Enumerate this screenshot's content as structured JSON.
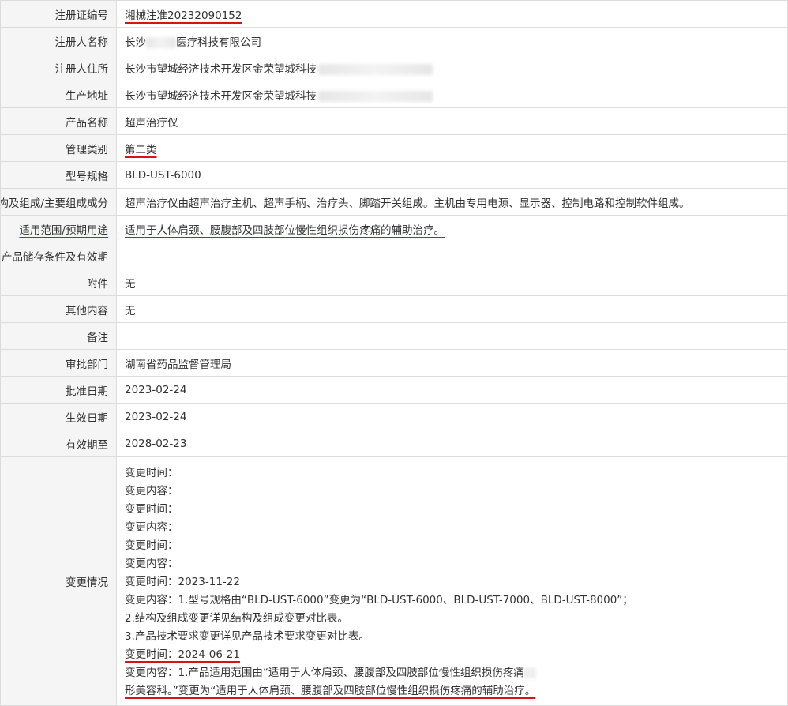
{
  "rows": [
    {
      "label": "注册证编号",
      "value": "湘械注准20232090152",
      "mark": true
    },
    {
      "label": "注册人名称",
      "value_prefix": "长沙",
      "value_suffix": "医疗科技有限公司",
      "redacted": true
    },
    {
      "label": "注册人住所",
      "value": "长沙市望城经济技术开发区金荣望城科技",
      "redacted_tail": true
    },
    {
      "label": "生产地址",
      "value": "长沙市望城经济技术开发区金荣望城科技",
      "redacted_tail": true
    },
    {
      "label": "产品名称",
      "value": "超声治疗仪"
    },
    {
      "label": "管理类别",
      "value": "第二类",
      "mark": true
    },
    {
      "label": "型号规格",
      "value": "BLD-UST-6000"
    },
    {
      "label": "结构及组成/主要组成成分",
      "value": "超声治疗仪由超声治疗主机、超声手柄、治疗头、脚踏开关组成。主机由专用电源、显示器、控制电路和控制软件组成。"
    },
    {
      "label": "适用范围/预期用途",
      "value": "适用于人体肩颈、腰腹部及四肢部位慢性组织损伤疼痛的辅助治疗。",
      "mark": true,
      "mark_label": true
    },
    {
      "label": "产品储存条件及有效期",
      "value": ""
    },
    {
      "label": "附件",
      "value": "无"
    },
    {
      "label": "其他内容",
      "value": "无"
    },
    {
      "label": "备注",
      "value": ""
    },
    {
      "label": "审批部门",
      "value": "湖南省药品监督管理局"
    },
    {
      "label": "批准日期",
      "value": "2023-02-24"
    },
    {
      "label": "生效日期",
      "value": "2023-02-24"
    },
    {
      "label": "有效期至",
      "value": "2028-02-23"
    }
  ],
  "changes": {
    "label": "变更情况",
    "lines": [
      "变更时间：",
      "变更内容：",
      "变更时间：",
      "变更内容：",
      "变更时间：",
      "变更内容：",
      "变更时间：2023-11-22",
      "变更内容：1.型号规格由“BLD-UST-6000”变更为“BLD-UST-6000、BLD-UST-7000、BLD-UST-8000”；",
      "2.结构及组成变更详见结构及组成变更对比表。",
      "3.产品技术要求变更详见产品技术要求变更对比表。",
      "变更时间：2024-06-21",
      "变更内容：1.产品适用范围由“适用于人体肩颈、腰腹部及四肢部位慢性组织损伤疼痛",
      "形美容科。”变更为“适用于人体肩颈、腰腹部及四肢部位慢性组织损伤疼痛的辅助治疗。"
    ],
    "marked_line_indexes": [
      10,
      12
    ]
  },
  "colors": {
    "underline": "#d21616",
    "label_bg": "#f5f5f5",
    "border": "#dcdcdc"
  }
}
